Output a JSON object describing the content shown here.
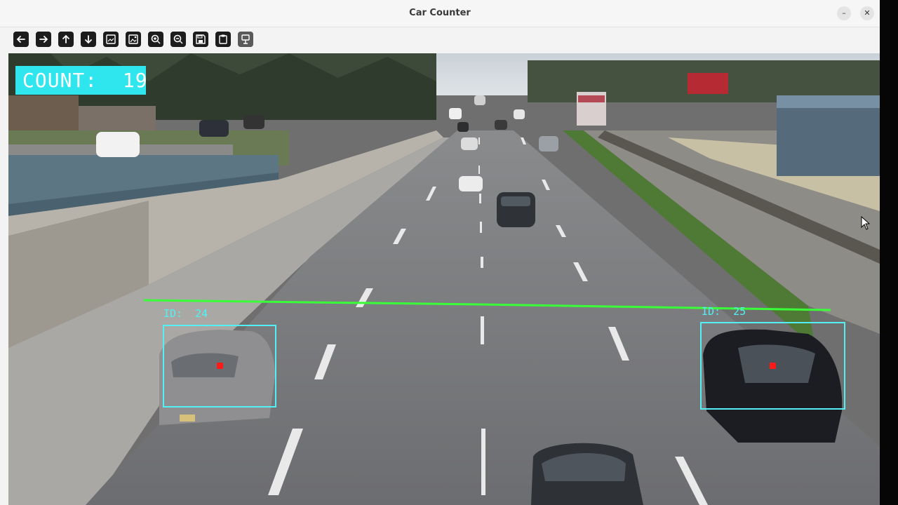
{
  "window": {
    "title": "Car Counter",
    "minimize_label": "–",
    "close_label": "✕"
  },
  "toolbar": {
    "buttons": [
      {
        "icon": "arrow-left-icon"
      },
      {
        "icon": "arrow-right-icon"
      },
      {
        "icon": "arrow-up-icon"
      },
      {
        "icon": "arrow-down-icon"
      },
      {
        "icon": "image-icon"
      },
      {
        "icon": "image-edit-icon"
      },
      {
        "icon": "zoom-in-icon"
      },
      {
        "icon": "zoom-out-icon"
      },
      {
        "icon": "save-icon"
      },
      {
        "icon": "clipboard-icon"
      },
      {
        "icon": "properties-icon"
      }
    ]
  },
  "overlay": {
    "count_text": "COUNT:  19",
    "detections": [
      {
        "id_text": "ID:  24"
      },
      {
        "id_text": "ID:  25"
      }
    ],
    "colors": {
      "count_bg": "#2fe6ee",
      "box": "#52f0f4",
      "line": "#38ff38",
      "centroid": "#ff1a1a"
    }
  }
}
